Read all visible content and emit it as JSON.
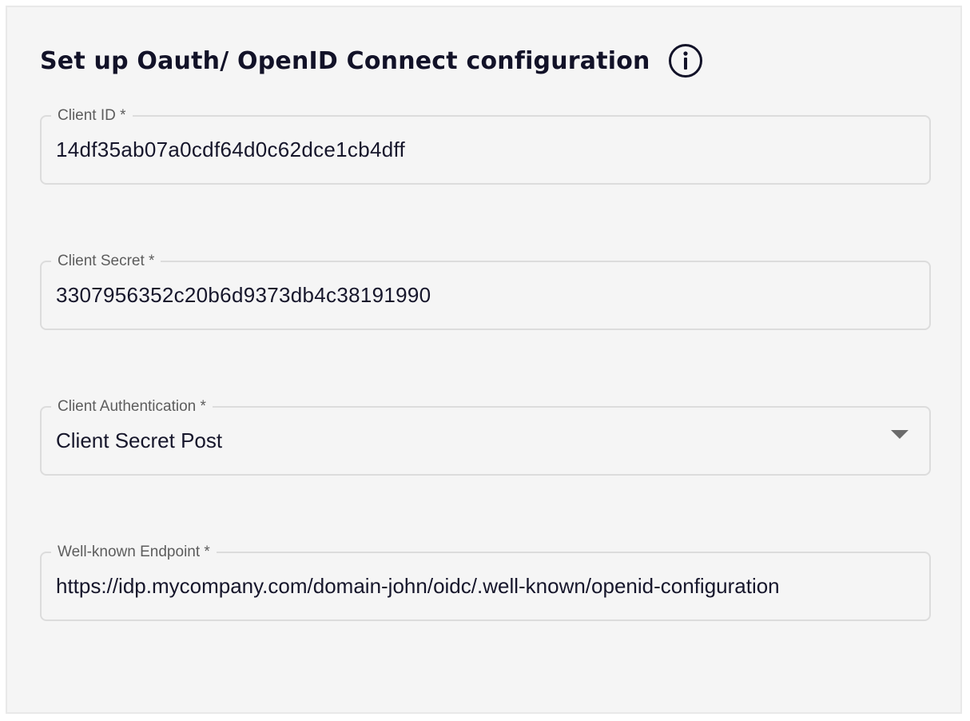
{
  "form": {
    "title": "Set up Oauth/ OpenID Connect configuration",
    "info_icon": "info-circle-icon",
    "fields": [
      {
        "label": "Client ID *",
        "value": "14df35ab07a0cdf64d0c62dce1cb4dff",
        "type": "text"
      },
      {
        "label": "Client Secret *",
        "value": "3307956352c20b6d9373db4c38191990",
        "type": "text"
      },
      {
        "label": "Client Authentication *",
        "value": "Client Secret Post",
        "type": "select",
        "icon": "caret-down-icon"
      },
      {
        "label": "Well-known Endpoint *",
        "value": "https://idp.mycompany.com/domain-john/oidc/.well-known/openid-configuration",
        "type": "text"
      }
    ]
  },
  "colors": {
    "panel_background": "#f5f5f5",
    "title_text": "#121228",
    "label_text": "#5d5d5d",
    "value_text": "#16162b",
    "field_border": "#dcdcdc"
  }
}
